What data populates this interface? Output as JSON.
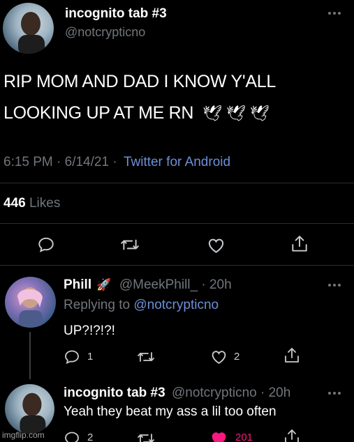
{
  "main_tweet": {
    "display_name": "incognito tab #3",
    "handle": "@notcrypticno",
    "text_line1": "RIP MOM AND DAD I KNOW Y'ALL",
    "text_line2": "LOOKING UP AT ME RN",
    "emoji": "🕊🕊🕊",
    "time": "6:15 PM · 6/14/21 ·",
    "source": "Twitter for Android",
    "likes_count": "446",
    "likes_label": "Likes"
  },
  "reply1": {
    "display_name": "Phill",
    "rocket_emoji": "🚀",
    "handle_time": "@MeekPhill_ · 20h",
    "replying_to_label": "Replying to",
    "replying_to_handle": "@notcrypticno",
    "text": "UP?!?!?!",
    "reply_count": "1",
    "like_count": "2"
  },
  "reply2": {
    "display_name": "incognito tab #3",
    "handle_time": "@notcrypticno · 20h",
    "text": "Yeah they beat my ass a lil too often",
    "reply_count": "2",
    "like_count": "201"
  },
  "watermark": "imgflip.com",
  "colors": {
    "background": "#000000",
    "link": "#6e8fd8",
    "muted": "#71767b",
    "like_red": "#f91880"
  }
}
